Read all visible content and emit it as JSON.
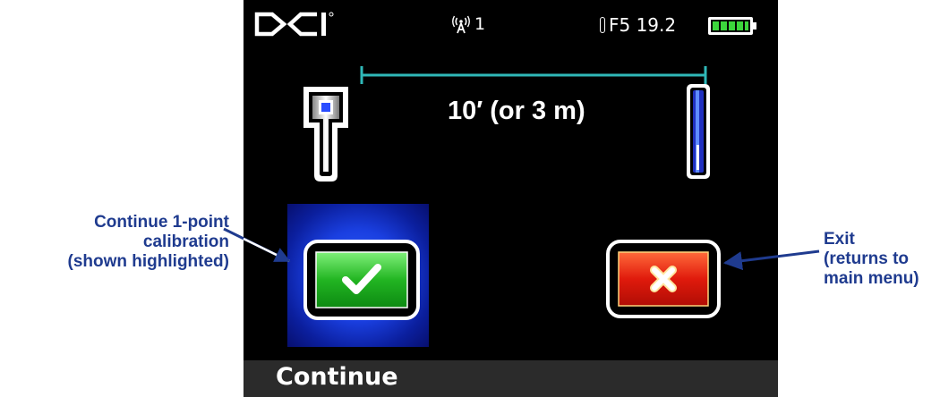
{
  "status_bar": {
    "logo": "DCI",
    "signal_value": "1",
    "frequency": "F5 19.2",
    "icons": [
      "dci-logo-icon",
      "antenna-signal-icon",
      "thermometer-icon",
      "battery-full-icon"
    ]
  },
  "main": {
    "distance_label": "10′ (or 3 m)",
    "icons": [
      "locator-icon",
      "transmitter-icon",
      "measurement-bracket-icon"
    ]
  },
  "buttons": {
    "continue_icon": "checkmark-icon",
    "exit_icon": "x-icon",
    "continue_color": "#22b522",
    "exit_color": "#e01a0c",
    "highlight_color": "#1a3fe0"
  },
  "softkey": {
    "label": "Continue"
  },
  "callouts": {
    "left": [
      "Continue 1-point",
      "calibration",
      "(shown highlighted)"
    ],
    "right": [
      "Exit",
      "(returns to",
      "main menu)"
    ],
    "color": "#1f3b8f"
  }
}
